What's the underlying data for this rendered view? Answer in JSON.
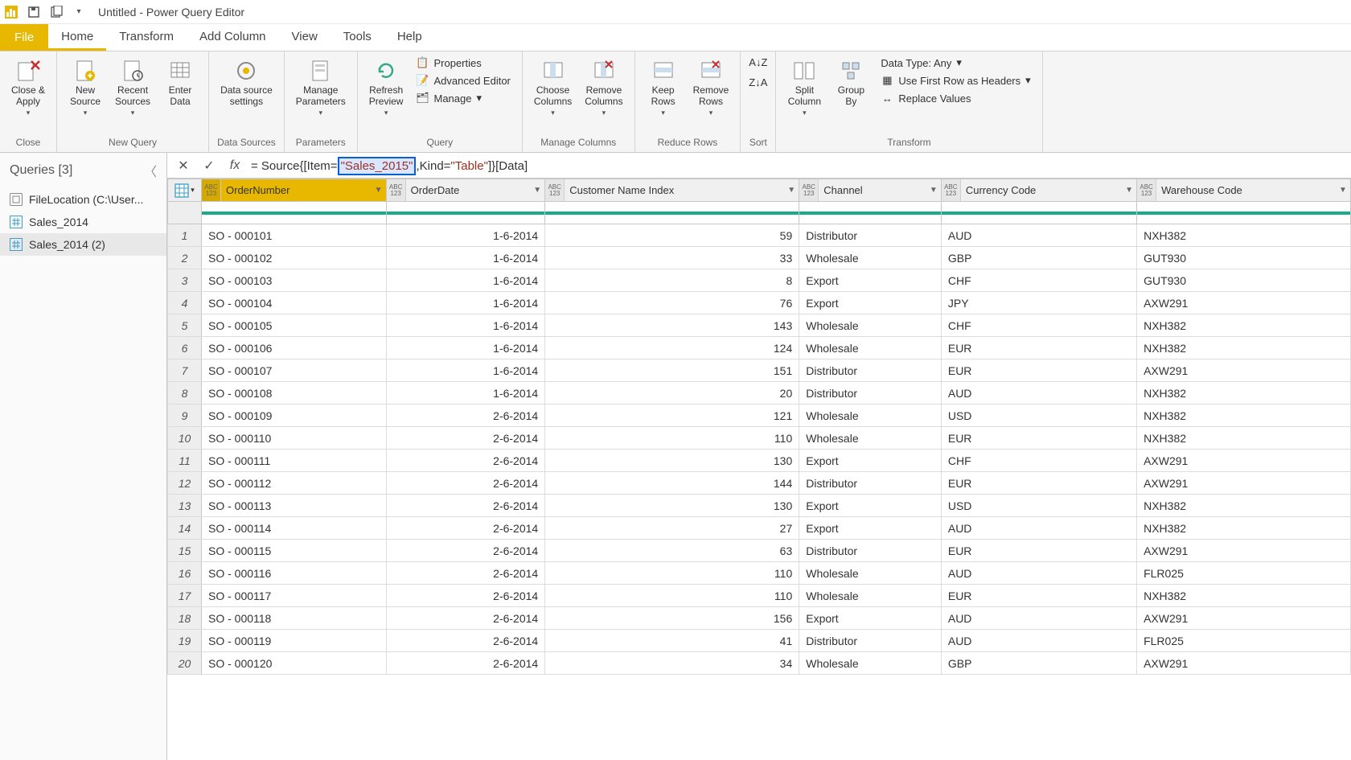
{
  "titlebar": {
    "title": "Untitled - Power Query Editor"
  },
  "menus": {
    "file": "File",
    "tabs": [
      "Home",
      "Transform",
      "Add Column",
      "View",
      "Tools",
      "Help"
    ],
    "active": "Home"
  },
  "ribbon": {
    "close": {
      "close_apply": "Close &\nApply",
      "group": "Close"
    },
    "new_query": {
      "new_source": "New\nSource",
      "recent_sources": "Recent\nSources",
      "enter_data": "Enter\nData",
      "group": "New Query"
    },
    "data_sources": {
      "settings": "Data source\nsettings",
      "group": "Data Sources"
    },
    "parameters": {
      "manage": "Manage\nParameters",
      "group": "Parameters"
    },
    "query": {
      "refresh": "Refresh\nPreview",
      "properties": "Properties",
      "advanced": "Advanced Editor",
      "manage": "Manage",
      "group": "Query"
    },
    "manage_cols": {
      "choose": "Choose\nColumns",
      "remove": "Remove\nColumns",
      "group": "Manage Columns"
    },
    "reduce": {
      "keep": "Keep\nRows",
      "remove": "Remove\nRows",
      "group": "Reduce Rows"
    },
    "sort": {
      "group": "Sort"
    },
    "transform": {
      "split": "Split\nColumn",
      "group_by": "Group\nBy",
      "data_type": "Data Type: Any",
      "first_row": "Use First Row as Headers",
      "replace": "Replace Values",
      "group": "Transform"
    }
  },
  "queries": {
    "header": "Queries [3]",
    "items": [
      {
        "label": "FileLocation (C:\\User..."
      },
      {
        "label": "Sales_2014"
      },
      {
        "label": "Sales_2014 (2)"
      }
    ]
  },
  "formula": {
    "prefix": "= Source{[Item=",
    "highlighted": "\"Sales_2015\"",
    "mid": ",Kind=",
    "kind": "\"Table\"",
    "suffix": "]}[Data]"
  },
  "columns": [
    {
      "name": "OrderNumber",
      "type_top": "ABC",
      "type_bot": "123",
      "align": "left"
    },
    {
      "name": "OrderDate",
      "type_top": "ABC",
      "type_bot": "123",
      "align": "right"
    },
    {
      "name": "Customer Name Index",
      "type_top": "ABC",
      "type_bot": "123",
      "align": "right"
    },
    {
      "name": "Channel",
      "type_top": "ABC",
      "type_bot": "123",
      "align": "left"
    },
    {
      "name": "Currency Code",
      "type_top": "ABC",
      "type_bot": "123",
      "align": "left"
    },
    {
      "name": "Warehouse Code",
      "type_top": "ABC",
      "type_bot": "123",
      "align": "left"
    }
  ],
  "rows": [
    [
      "SO - 000101",
      "1-6-2014",
      "59",
      "Distributor",
      "AUD",
      "NXH382"
    ],
    [
      "SO - 000102",
      "1-6-2014",
      "33",
      "Wholesale",
      "GBP",
      "GUT930"
    ],
    [
      "SO - 000103",
      "1-6-2014",
      "8",
      "Export",
      "CHF",
      "GUT930"
    ],
    [
      "SO - 000104",
      "1-6-2014",
      "76",
      "Export",
      "JPY",
      "AXW291"
    ],
    [
      "SO - 000105",
      "1-6-2014",
      "143",
      "Wholesale",
      "CHF",
      "NXH382"
    ],
    [
      "SO - 000106",
      "1-6-2014",
      "124",
      "Wholesale",
      "EUR",
      "NXH382"
    ],
    [
      "SO - 000107",
      "1-6-2014",
      "151",
      "Distributor",
      "EUR",
      "AXW291"
    ],
    [
      "SO - 000108",
      "1-6-2014",
      "20",
      "Distributor",
      "AUD",
      "NXH382"
    ],
    [
      "SO - 000109",
      "2-6-2014",
      "121",
      "Wholesale",
      "USD",
      "NXH382"
    ],
    [
      "SO - 000110",
      "2-6-2014",
      "110",
      "Wholesale",
      "EUR",
      "NXH382"
    ],
    [
      "SO - 000111",
      "2-6-2014",
      "130",
      "Export",
      "CHF",
      "AXW291"
    ],
    [
      "SO - 000112",
      "2-6-2014",
      "144",
      "Distributor",
      "EUR",
      "AXW291"
    ],
    [
      "SO - 000113",
      "2-6-2014",
      "130",
      "Export",
      "USD",
      "NXH382"
    ],
    [
      "SO - 000114",
      "2-6-2014",
      "27",
      "Export",
      "AUD",
      "NXH382"
    ],
    [
      "SO - 000115",
      "2-6-2014",
      "63",
      "Distributor",
      "EUR",
      "AXW291"
    ],
    [
      "SO - 000116",
      "2-6-2014",
      "110",
      "Wholesale",
      "AUD",
      "FLR025"
    ],
    [
      "SO - 000117",
      "2-6-2014",
      "110",
      "Wholesale",
      "EUR",
      "NXH382"
    ],
    [
      "SO - 000118",
      "2-6-2014",
      "156",
      "Export",
      "AUD",
      "AXW291"
    ],
    [
      "SO - 000119",
      "2-6-2014",
      "41",
      "Distributor",
      "AUD",
      "FLR025"
    ],
    [
      "SO - 000120",
      "2-6-2014",
      "34",
      "Wholesale",
      "GBP",
      "AXW291"
    ]
  ]
}
